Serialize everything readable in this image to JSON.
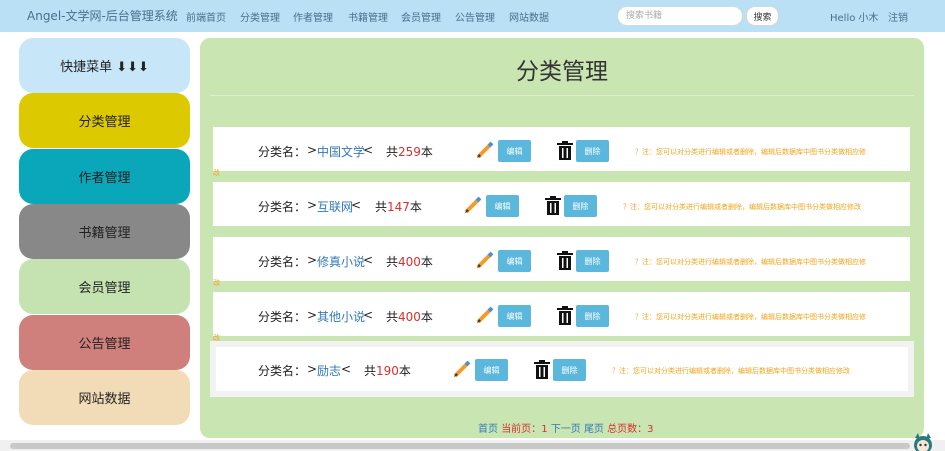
{
  "navbar": {
    "brand": "Angel-文学网-后台管理系统",
    "links": [
      "前端首页",
      "分类管理",
      "作者管理",
      "书籍管理",
      "会员管理",
      "公告管理",
      "网站数据"
    ],
    "search_placeholder": "搜索书籍",
    "search_button": "搜索",
    "hello": "Hello 小木",
    "logout": "注销"
  },
  "sidebar": {
    "items": [
      {
        "label": "快捷菜单 ⬇⬇⬇",
        "color": "#c7e7f8"
      },
      {
        "label": "分类管理",
        "color": "#dcc900"
      },
      {
        "label": "作者管理",
        "color": "#0aa6b9"
      },
      {
        "label": "书籍管理",
        "color": "#888888"
      },
      {
        "label": "会员管理",
        "color": "#c5e3b1"
      },
      {
        "label": "公告管理",
        "color": "#cf7f7c"
      },
      {
        "label": "网站数据",
        "color": "#f2dcb7"
      }
    ]
  },
  "main": {
    "title": "分类管理",
    "label": "分类名：",
    "prefix": ">",
    "suffix": "<",
    "count_prefix": "共",
    "count_suffix": "本",
    "edit_label": "编辑",
    "delete_label": "删除",
    "note": "？注：您可以对分类进行编辑或者删除，编辑后数据库中图书分类做相应修改",
    "note_wrapped_head": "？注：您可以对分类进行编辑或者删除，编辑后数据库中图书分类做相应修",
    "note_wrapped_tail": "改",
    "categories": [
      {
        "name": "中国文学",
        "count": "259"
      },
      {
        "name": "互联网",
        "count": "147"
      },
      {
        "name": "修真小说",
        "count": "400"
      },
      {
        "name": "其他小说",
        "count": "400"
      },
      {
        "name": "励志",
        "count": "190"
      }
    ]
  },
  "pager": {
    "first": "首页",
    "current_label": "当前页：",
    "current": "1",
    "next": "下一页",
    "last": "尾页",
    "total_label": "总页数：",
    "total": "3"
  }
}
